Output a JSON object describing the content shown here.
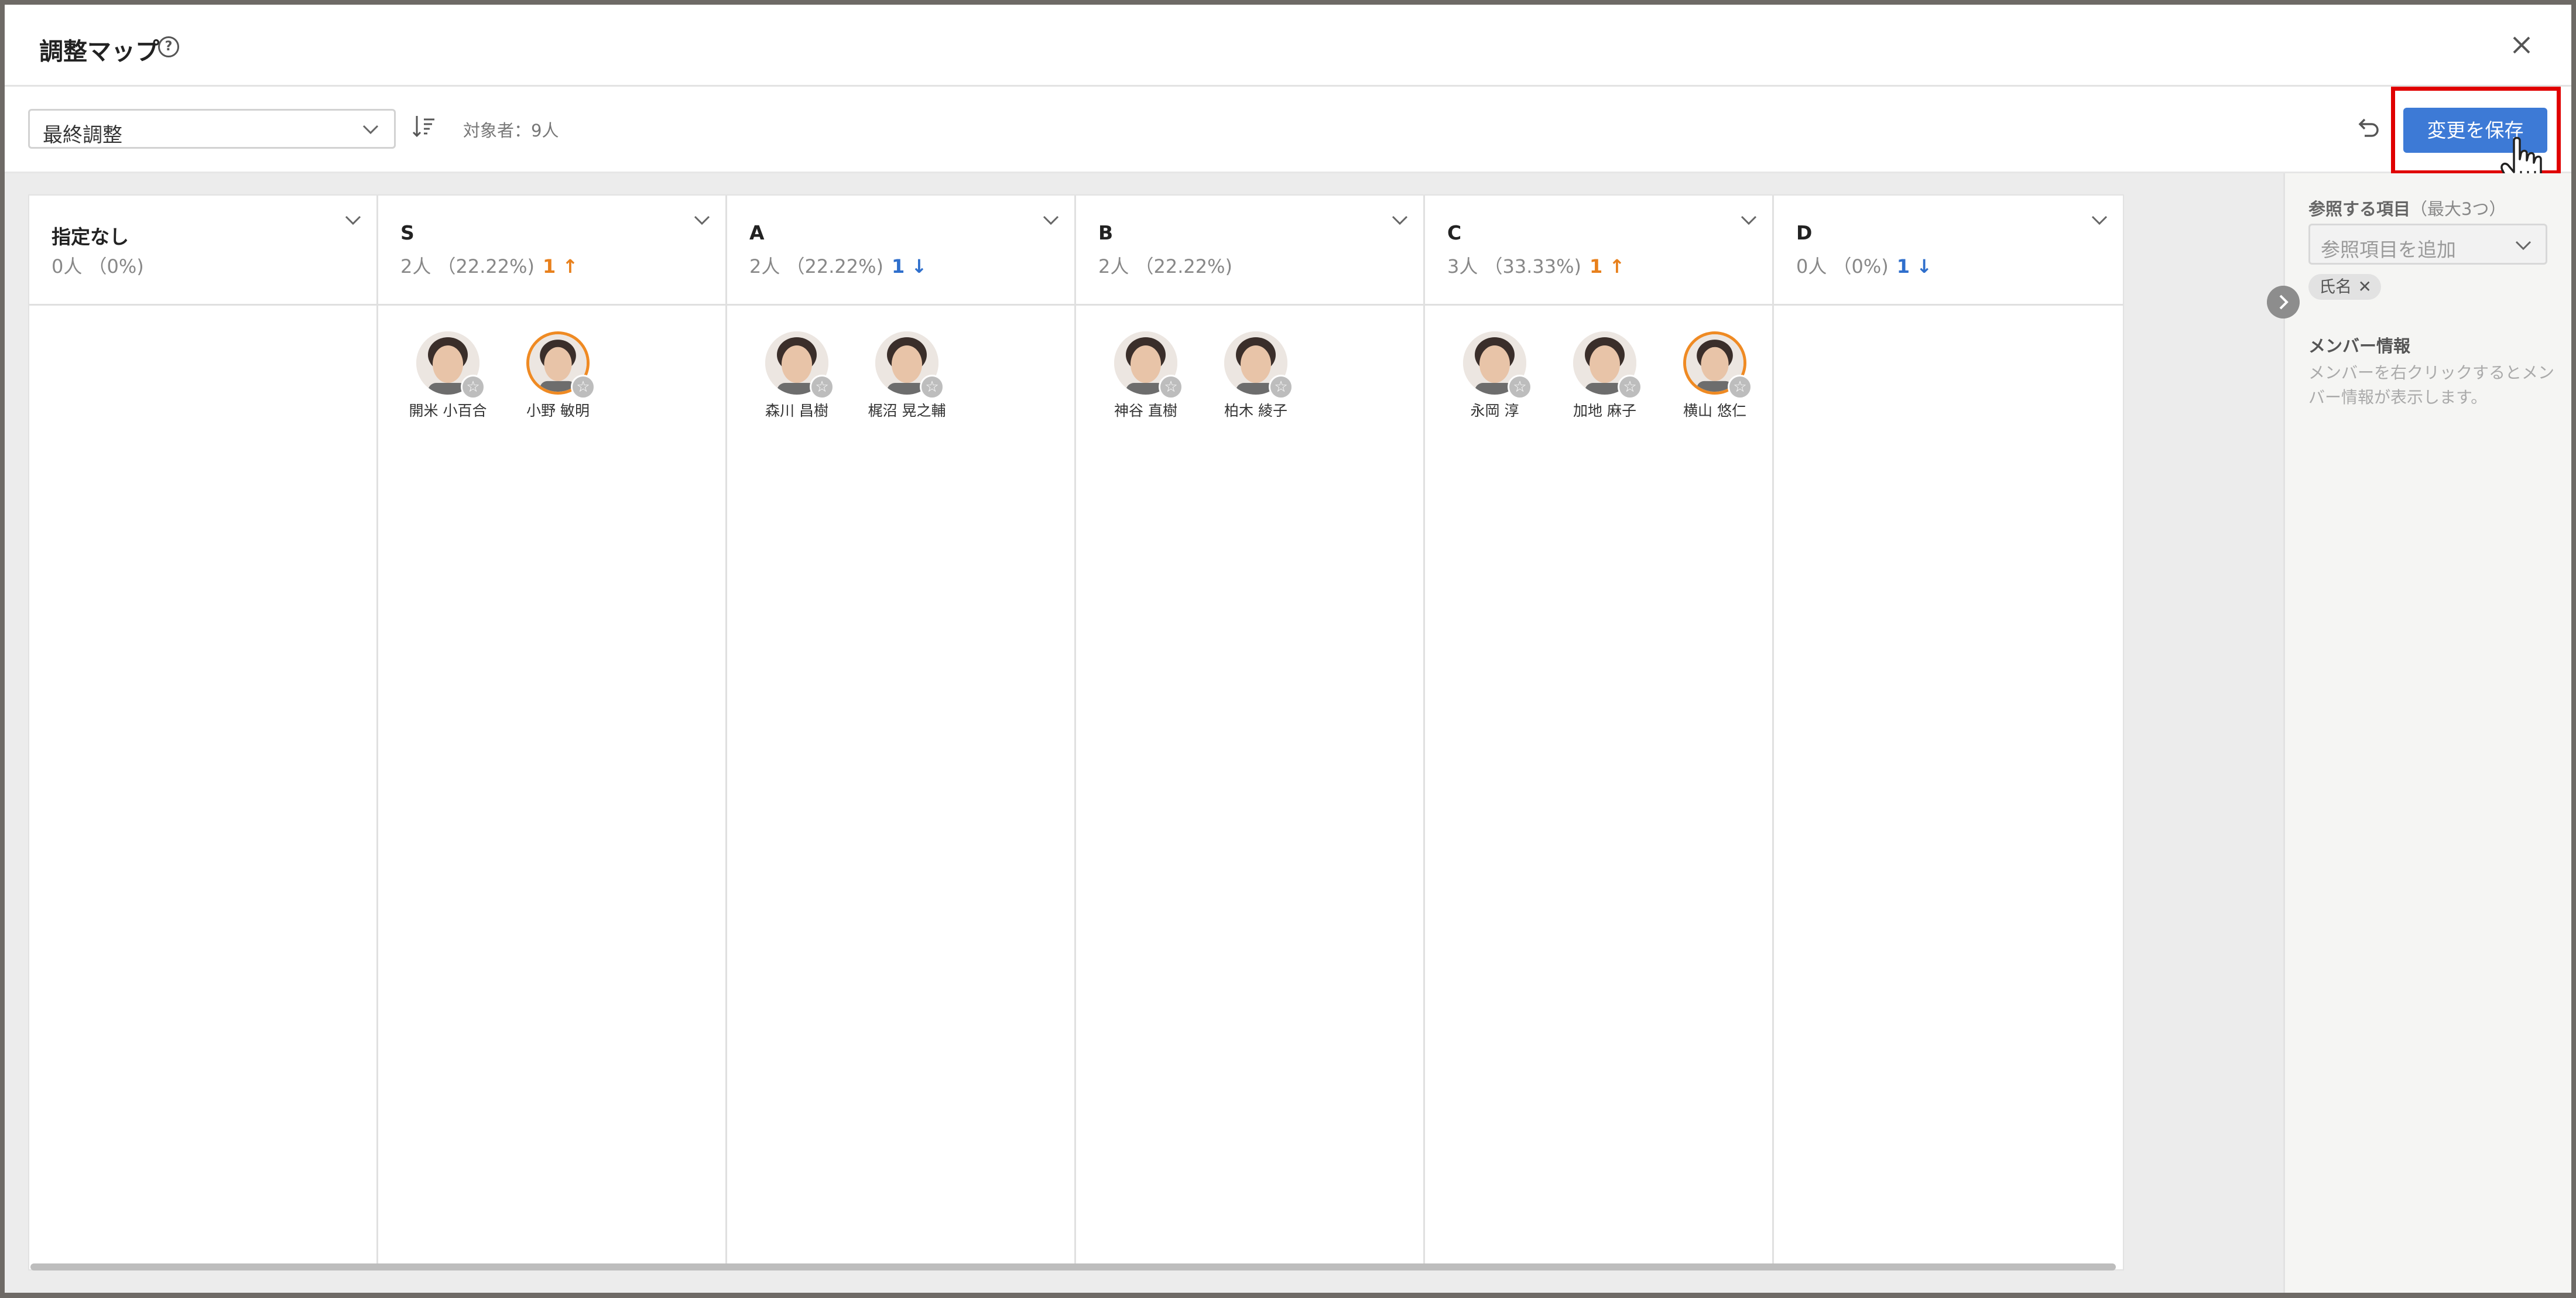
{
  "modal": {
    "title": "調整マップ"
  },
  "toolbar": {
    "stage_select": "最終調整",
    "target_count": "対象者：9人",
    "save_label": "変更を保存"
  },
  "columns": [
    {
      "name": "指定なし",
      "stats": "0人 （0%)",
      "delta": "",
      "direction": "",
      "members": []
    },
    {
      "name": "S",
      "stats": "2人 （22.22%)",
      "delta": "1 ↑",
      "direction": "up",
      "members": [
        {
          "name": "開米 小百合",
          "highlighted": false
        },
        {
          "name": "小野 敏明",
          "highlighted": true
        }
      ]
    },
    {
      "name": "A",
      "stats": "2人 （22.22%)",
      "delta": "1 ↓",
      "direction": "down",
      "members": [
        {
          "name": "森川 昌樹",
          "highlighted": false
        },
        {
          "name": "梶沼 晃之輔",
          "highlighted": false
        }
      ]
    },
    {
      "name": "B",
      "stats": "2人 （22.22%)",
      "delta": "",
      "direction": "",
      "members": [
        {
          "name": "神谷 直樹",
          "highlighted": false
        },
        {
          "name": "柏木 綾子",
          "highlighted": false
        }
      ]
    },
    {
      "name": "C",
      "stats": "3人 （33.33%)",
      "delta": "1 ↑",
      "direction": "up",
      "members": [
        {
          "name": "永岡 淳",
          "highlighted": false
        },
        {
          "name": "加地 麻子",
          "highlighted": false
        },
        {
          "name": "横山 悠仁",
          "highlighted": true
        }
      ]
    },
    {
      "name": "D",
      "stats": "0人 （0%)",
      "delta": "1 ↓",
      "direction": "down",
      "members": []
    }
  ],
  "side": {
    "ref_label": "参照する項目",
    "ref_sub": "（最大3つ）",
    "ref_placeholder": "参照項目を追加",
    "chip": "氏名",
    "info_title": "メンバー情報",
    "info_text": "メンバーを右クリックするとメンバー情報が表示します。"
  },
  "colors": {
    "accent": "#3d7ad6",
    "up": "#e8801c",
    "down": "#2f6fcc",
    "highlight_box": "#e00000"
  }
}
